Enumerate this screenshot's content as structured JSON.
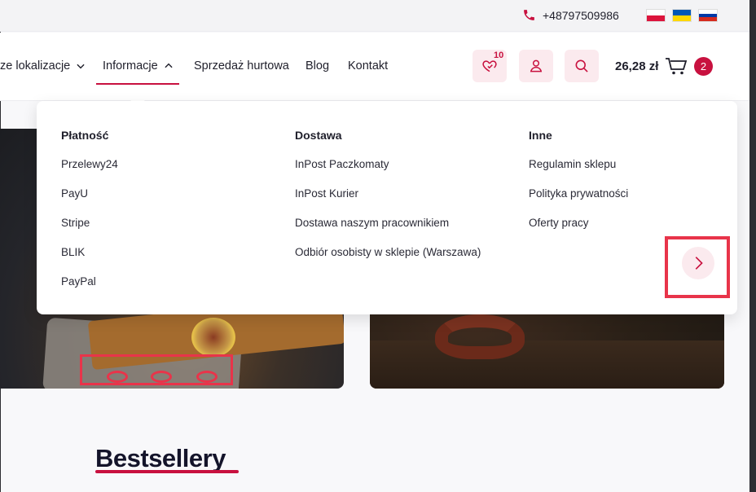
{
  "topbar": {
    "phone": "+48797509986",
    "phone_icon": "phone-icon",
    "languages": [
      "Polski",
      "Українська",
      "Русский"
    ]
  },
  "nav": {
    "items": [
      {
        "label": "ze lokalizacje",
        "has_dropdown": true,
        "open": false
      },
      {
        "label": "Informacje",
        "has_dropdown": true,
        "open": true
      },
      {
        "label": "Sprzedaż hurtowa",
        "has_dropdown": false
      },
      {
        "label": "Blog",
        "has_dropdown": false
      },
      {
        "label": "Kontakt",
        "has_dropdown": false
      }
    ]
  },
  "header_actions": {
    "wishlist_count": "10",
    "wishlist_icon": "heart-check-icon",
    "account_icon": "user-icon",
    "search_icon": "search-icon",
    "cart_total": "26,28 zł",
    "cart_icon": "cart-icon",
    "cart_count": "2"
  },
  "dropdown": {
    "columns": [
      {
        "title": "Płatność",
        "links": [
          "Przelewy24",
          "PayU",
          "Stripe",
          "BLIK",
          "PayPal"
        ]
      },
      {
        "title": "Dostawa",
        "links": [
          "InPost Paczkomaty",
          "InPost Kurier",
          "Dostawa naszym pracownikiem",
          "Odbiór osobisty w sklepie (Warszawa)"
        ]
      },
      {
        "title": "Inne",
        "links": [
          "Regulamin sklepu",
          "Polityka prywatności",
          "Oferty pracy"
        ]
      }
    ]
  },
  "carousel": {
    "next_icon": "chevron-right-icon",
    "dots": 3
  },
  "section": {
    "title": "Bestsellery"
  },
  "colors": {
    "accent": "#c8113f",
    "accent_light": "#fbeaee",
    "annotation": "#e8344a"
  }
}
